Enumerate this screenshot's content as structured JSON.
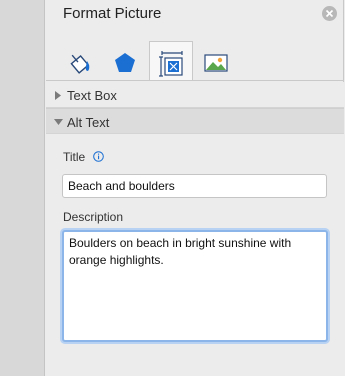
{
  "panel": {
    "title": "Format Picture"
  },
  "tabs": [
    {
      "name": "fill-line",
      "icon": "paint-bucket-icon"
    },
    {
      "name": "effects",
      "icon": "pentagon-icon"
    },
    {
      "name": "size-properties",
      "icon": "size-properties-icon",
      "active": true
    },
    {
      "name": "picture",
      "icon": "picture-icon"
    }
  ],
  "sections": {
    "text_box": {
      "label": "Text Box",
      "expanded": false
    },
    "alt_text": {
      "label": "Alt Text",
      "expanded": true
    }
  },
  "alt_text": {
    "title_label": "Title",
    "title_value": "Beach and boulders",
    "description_label": "Description",
    "description_value": "Boulders on beach in bright sunshine with orange highlights."
  },
  "colors": {
    "accent_blue": "#1b6fd2",
    "focus_ring": "#8cb6ea"
  }
}
